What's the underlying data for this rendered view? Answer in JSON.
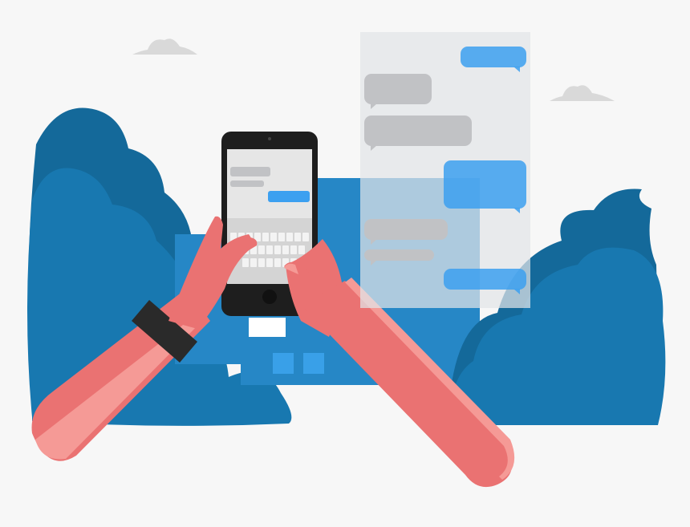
{
  "colors": {
    "background": "#f7f7f7",
    "bush_dark": "#14699a",
    "bush_light": "#1878b0",
    "building": "#2687c6",
    "window": "#39a0e8",
    "skin": "#ea7272",
    "skin_highlight": "#f59a96",
    "wristband": "#2a2a2a",
    "phone_body": "#1e1e1e",
    "screen": "#e6e6e6",
    "bubble_in": "#c1c2c5",
    "bubble_out": "#3ca0f0",
    "panel": "#e2e4e8",
    "cloud": "#d9d9d9"
  },
  "icons": [
    "cloud-icon",
    "smartphone-icon",
    "chat-bubble-icon",
    "keyboard-icon"
  ],
  "chat_panel": {
    "bubbles": [
      {
        "side": "out"
      },
      {
        "side": "in"
      },
      {
        "side": "in"
      },
      {
        "side": "out"
      },
      {
        "side": "in"
      },
      {
        "side": "in"
      },
      {
        "side": "out"
      }
    ]
  }
}
